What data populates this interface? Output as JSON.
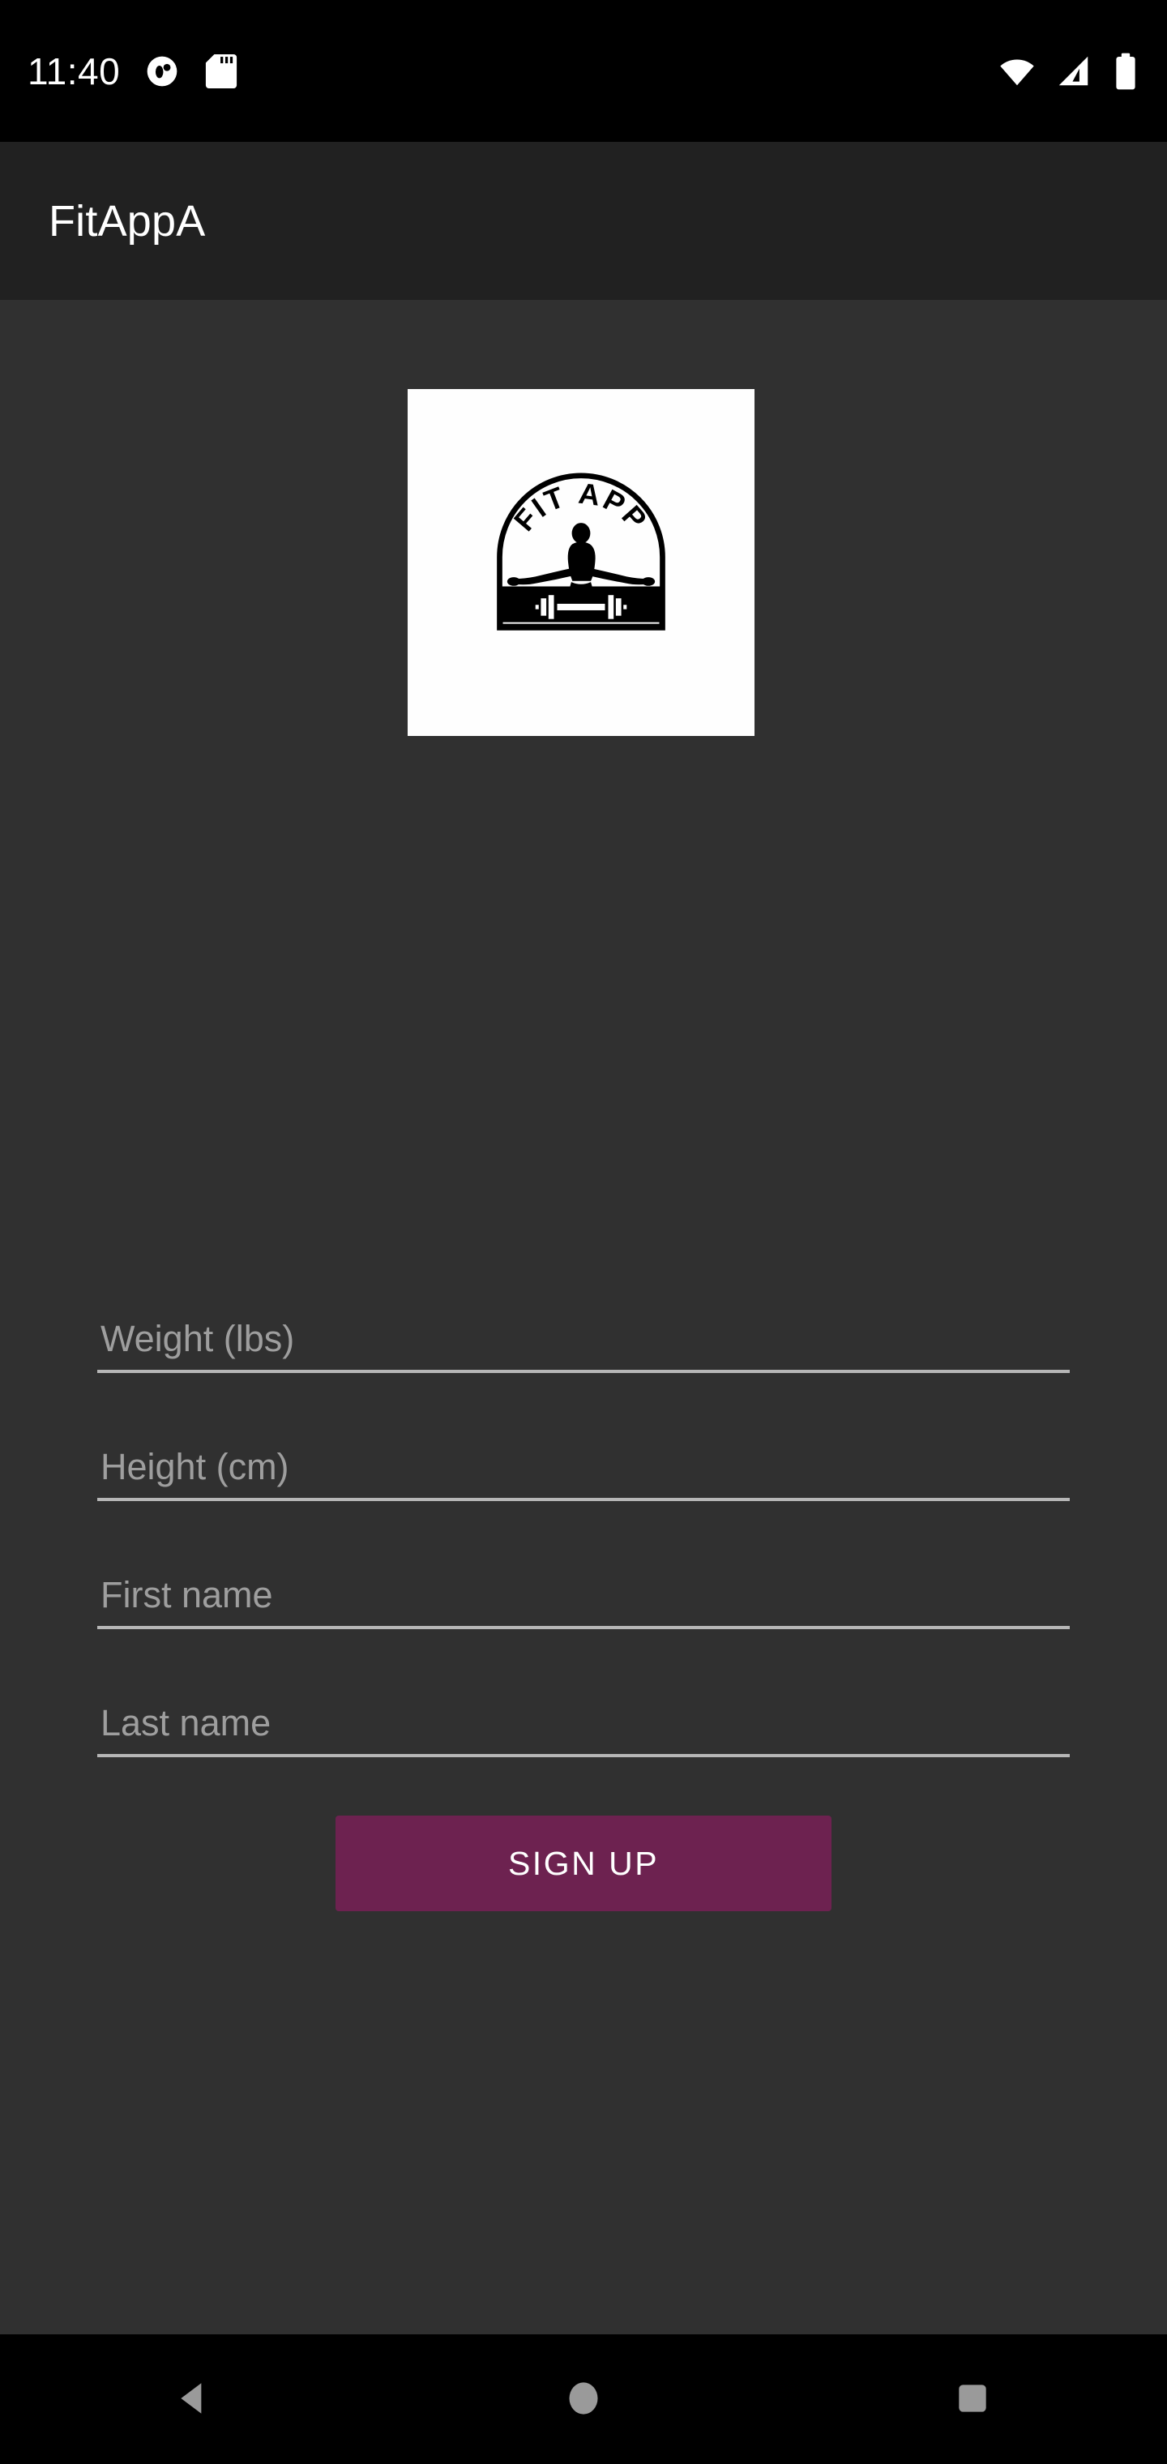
{
  "statusbar": {
    "time": "11:40",
    "left_icons": [
      {
        "name": "notification-dot-icon",
        "label": "notification"
      },
      {
        "name": "sd-card-icon",
        "label": "sd card"
      }
    ],
    "right_icons": [
      {
        "name": "wifi-icon",
        "label": "wifi full"
      },
      {
        "name": "cellular-signal-icon",
        "label": "cellular signal"
      },
      {
        "name": "battery-icon",
        "label": "battery full"
      }
    ],
    "background_color": "#000000",
    "foreground_color": "#ffffff"
  },
  "appbar": {
    "title": "FitAppA",
    "background_color": "#212121",
    "title_color": "#ffffff"
  },
  "content": {
    "background_color": "#303030",
    "logo": {
      "name": "fit-app-logo",
      "arc_text": "FIT APP",
      "background_color": "#fefefe",
      "mark_color": "#000000"
    }
  },
  "form": {
    "fields": [
      {
        "name": "weight-input",
        "placeholder": "Weight (lbs)",
        "value": ""
      },
      {
        "name": "height-input",
        "placeholder": "Height (cm)",
        "value": ""
      },
      {
        "name": "first-name-input",
        "placeholder": "First name",
        "value": ""
      },
      {
        "name": "last-name-input",
        "placeholder": "Last name",
        "value": ""
      }
    ],
    "placeholder_color": "#9e9e9e",
    "underline_color": "#b6b6b6"
  },
  "actions": {
    "signup_label": "SIGN UP",
    "signup_color": "#6d2250",
    "signup_text_color": "#ffffff"
  },
  "navbar": {
    "background_color": "#000000",
    "icon_color": "#9a9a9a",
    "buttons": [
      {
        "name": "nav-back-button",
        "icon": "back-triangle-icon"
      },
      {
        "name": "nav-home-button",
        "icon": "home-circle-icon"
      },
      {
        "name": "nav-recents-button",
        "icon": "recents-square-icon"
      }
    ]
  }
}
